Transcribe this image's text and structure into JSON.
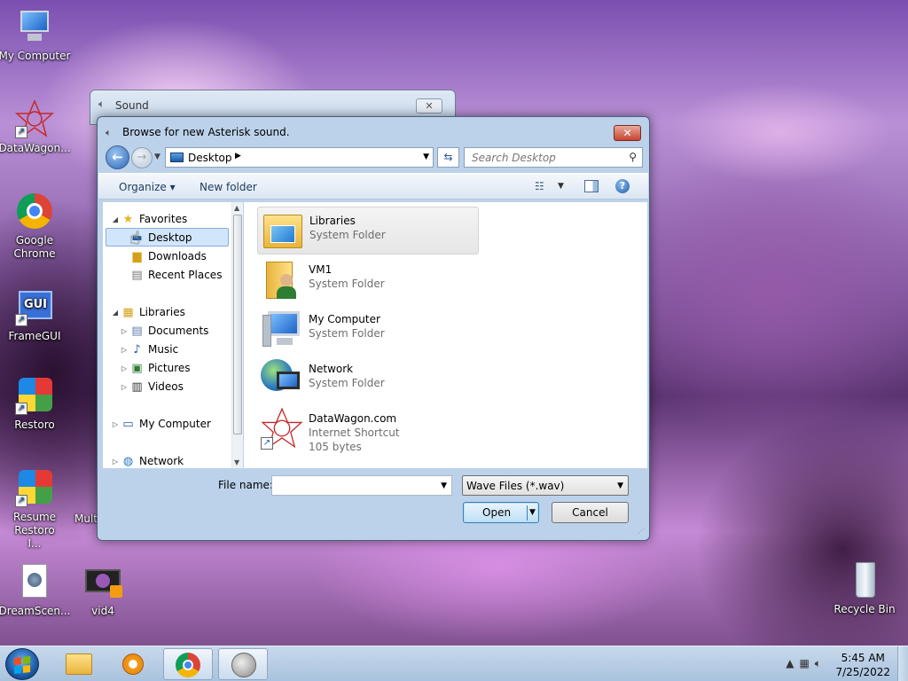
{
  "desktop": {
    "icons": [
      {
        "label": "My Computer",
        "icon": "computer-icon"
      },
      {
        "label": "DataWagon...",
        "icon": "datawagon-icon"
      },
      {
        "label": "Google Chrome",
        "icon": "chrome-icon"
      },
      {
        "label": "FrameGUI",
        "icon": "framegui-icon"
      },
      {
        "label": "Restoro",
        "icon": "restoro-icon"
      },
      {
        "label": "Resume Restoro I...",
        "icon": "restoro-icon"
      },
      {
        "label": "DreamScen...",
        "icon": "dreamscene-icon"
      },
      {
        "label": "vid4",
        "icon": "video-icon"
      },
      {
        "label": "Recycle Bin",
        "icon": "recycle-bin-icon"
      },
      {
        "label": "Mult",
        "icon": "partial-icon"
      }
    ]
  },
  "back_window": {
    "title": "Sound",
    "close": "✕"
  },
  "dialog": {
    "title": "Browse for new Asterisk sound.",
    "close": "✕",
    "address": {
      "location": "Desktop"
    },
    "search": {
      "placeholder": "Search Desktop"
    },
    "toolbar": {
      "organize": "Organize ▾",
      "new_folder": "New folder",
      "help": "?"
    },
    "nav_pane": {
      "favorites": "Favorites",
      "favorites_items": [
        "Desktop",
        "Downloads",
        "Recent Places"
      ],
      "libraries": "Libraries",
      "libraries_items": [
        "Documents",
        "Music",
        "Pictures",
        "Videos"
      ],
      "my_computer": "My Computer",
      "network": "Network",
      "selected": "Desktop"
    },
    "files": [
      {
        "name": "Libraries",
        "type": "System Folder",
        "icon": "libraries-folder-icon"
      },
      {
        "name": "VM1",
        "type": "System Folder",
        "icon": "user-folder-icon"
      },
      {
        "name": "My Computer",
        "type": "System Folder",
        "icon": "computer-icon"
      },
      {
        "name": "Network",
        "type": "System Folder",
        "icon": "network-icon"
      },
      {
        "name": "DataWagon.com",
        "type": "Internet Shortcut",
        "size": "105 bytes",
        "icon": "datawagon-icon"
      }
    ],
    "file_name_label": "File name:",
    "file_name_value": "",
    "file_type": "Wave Files (*.wav)",
    "open": "Open",
    "cancel": "Cancel"
  },
  "taskbar": {
    "clock_time": "5:45 AM",
    "clock_date": "7/25/2022",
    "buttons": [
      "explorer-icon",
      "media-player-icon",
      "chrome-icon",
      "sound-icon"
    ]
  },
  "colors": {
    "selection": "#d2e6fb",
    "accent": "#3c7fb1"
  }
}
